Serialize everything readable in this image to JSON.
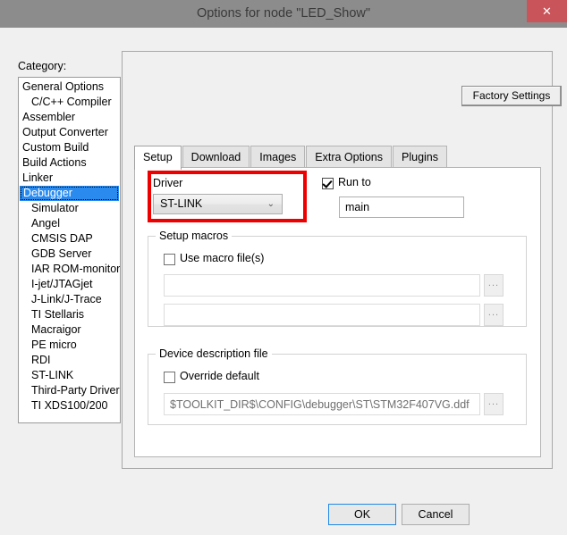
{
  "window": {
    "title": "Options for node \"LED_Show\"",
    "close_icon": "close-icon",
    "close_glyph": "✕"
  },
  "colors": {
    "titlebar": "#8c8c8c",
    "close_button": "#c9545a",
    "selection": "#2a8aee",
    "annotation": "#ee0000",
    "default_button_focus": "#1f88e5"
  },
  "category": {
    "label": "Category:",
    "items": [
      {
        "label": "General Options",
        "indent": false,
        "selected": false
      },
      {
        "label": "C/C++ Compiler",
        "indent": true,
        "selected": false
      },
      {
        "label": "Assembler",
        "indent": false,
        "selected": false
      },
      {
        "label": "Output Converter",
        "indent": false,
        "selected": false
      },
      {
        "label": "Custom Build",
        "indent": false,
        "selected": false
      },
      {
        "label": "Build Actions",
        "indent": false,
        "selected": false
      },
      {
        "label": "Linker",
        "indent": false,
        "selected": false
      },
      {
        "label": "Debugger",
        "indent": false,
        "selected": true
      },
      {
        "label": "Simulator",
        "indent": true,
        "selected": false
      },
      {
        "label": "Angel",
        "indent": true,
        "selected": false
      },
      {
        "label": "CMSIS DAP",
        "indent": true,
        "selected": false
      },
      {
        "label": "GDB Server",
        "indent": true,
        "selected": false
      },
      {
        "label": "IAR ROM-monitor",
        "indent": true,
        "selected": false
      },
      {
        "label": "I-jet/JTAGjet",
        "indent": true,
        "selected": false
      },
      {
        "label": "J-Link/J-Trace",
        "indent": true,
        "selected": false
      },
      {
        "label": "TI Stellaris",
        "indent": true,
        "selected": false
      },
      {
        "label": "Macraigor",
        "indent": true,
        "selected": false
      },
      {
        "label": "PE micro",
        "indent": true,
        "selected": false
      },
      {
        "label": "RDI",
        "indent": true,
        "selected": false
      },
      {
        "label": "ST-LINK",
        "indent": true,
        "selected": false
      },
      {
        "label": "Third-Party Driver",
        "indent": true,
        "selected": false
      },
      {
        "label": "TI XDS100/200",
        "indent": true,
        "selected": false
      }
    ]
  },
  "panel": {
    "factory_settings_label": "Factory Settings",
    "tabs": [
      {
        "label": "Setup",
        "active": true
      },
      {
        "label": "Download",
        "active": false
      },
      {
        "label": "Images",
        "active": false
      },
      {
        "label": "Extra Options",
        "active": false
      },
      {
        "label": "Plugins",
        "active": false
      }
    ]
  },
  "setup": {
    "driver": {
      "label": "Driver",
      "selected_value": "ST-LINK",
      "arrow_glyph": "⌄",
      "highlighted": true
    },
    "run_to": {
      "label": "Run to",
      "checked": true,
      "value": "main",
      "placeholder": ""
    },
    "setup_macros": {
      "title": "Setup macros",
      "use_macro_files": {
        "label": "Use macro file(s)",
        "checked": false
      },
      "file1": {
        "value": "",
        "placeholder": ""
      },
      "file2": {
        "value": "",
        "placeholder": ""
      },
      "browse_label": "..."
    },
    "device_description": {
      "title": "Device description file",
      "override_default": {
        "label": "Override default",
        "checked": false
      },
      "path": {
        "value": "$TOOLKIT_DIR$\\CONFIG\\debugger\\ST\\STM32F407VG.ddf",
        "placeholder": ""
      },
      "browse_label": "..."
    }
  },
  "footer": {
    "ok_label": "OK",
    "cancel_label": "Cancel"
  }
}
